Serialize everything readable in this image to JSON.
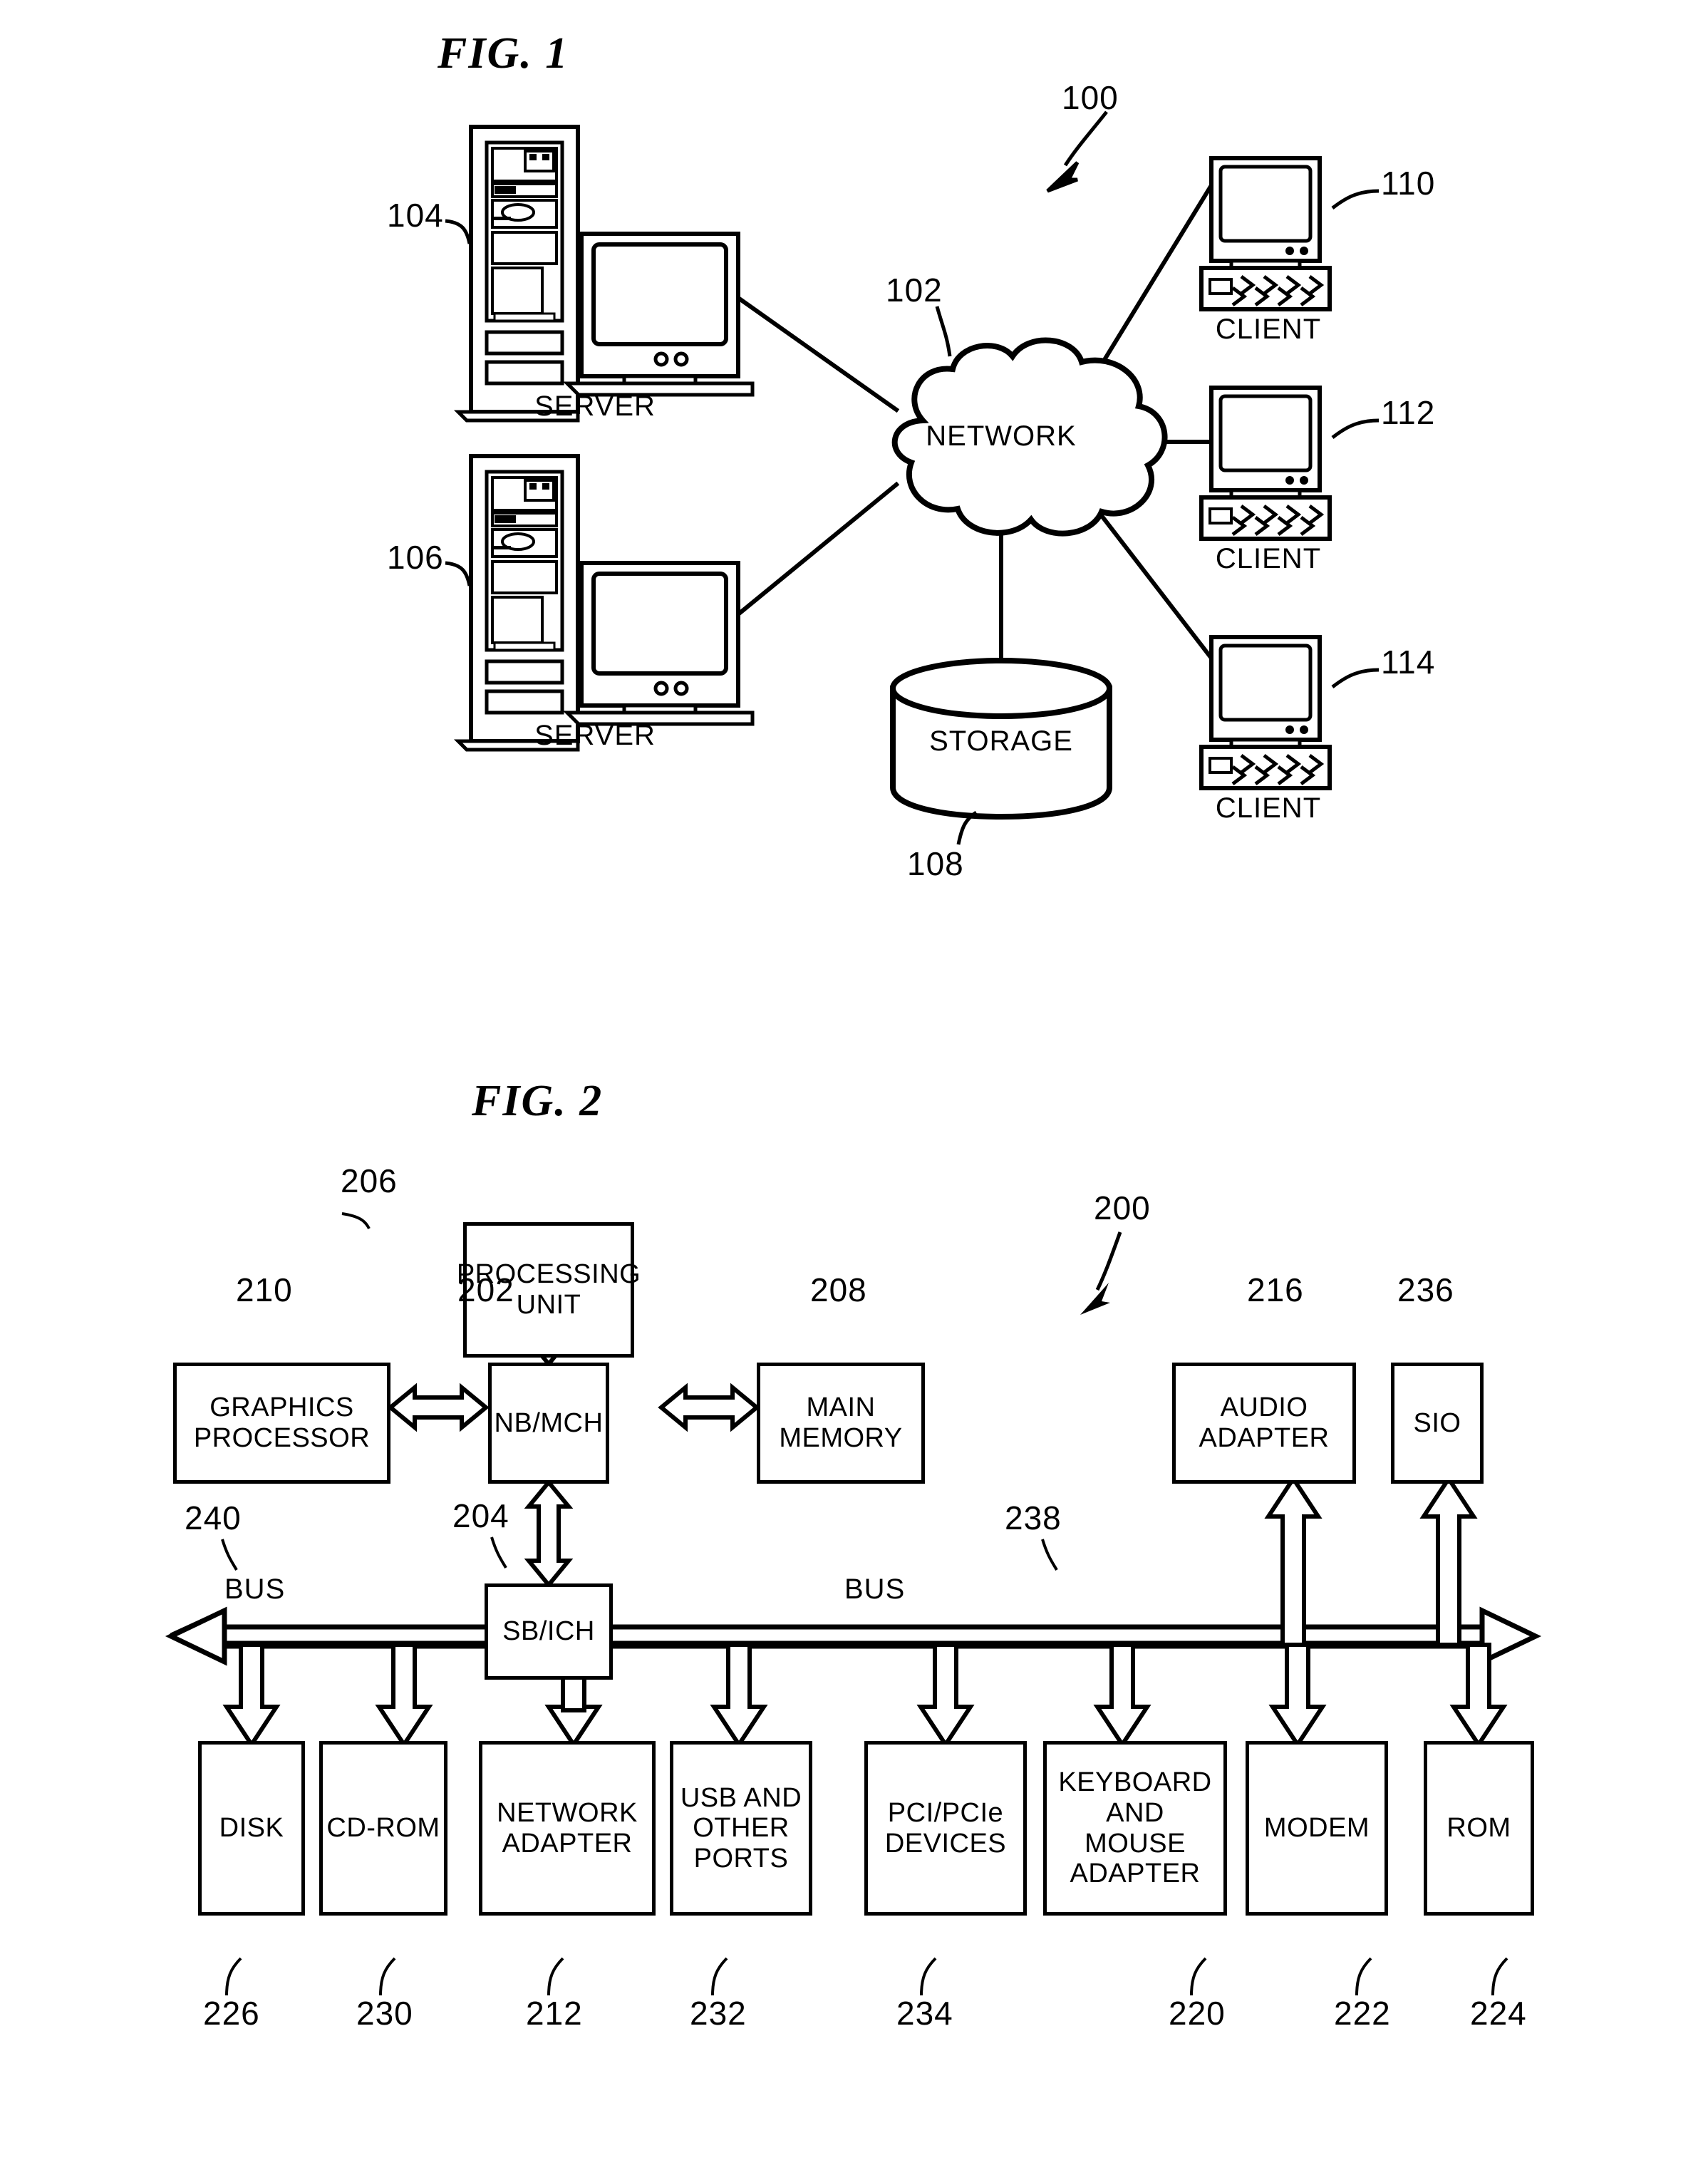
{
  "figures": [
    {
      "id": "fig1",
      "title": "FIG. 1",
      "system_ref": "100",
      "nodes": [
        {
          "ref": "104",
          "label": "SERVER",
          "type": "server-tower-with-monitor"
        },
        {
          "ref": "106",
          "label": "SERVER",
          "type": "server-tower-with-monitor"
        },
        {
          "ref": "102",
          "label": "NETWORK",
          "type": "cloud"
        },
        {
          "ref": "108",
          "label": "STORAGE",
          "type": "cylinder"
        },
        {
          "ref": "110",
          "label": "CLIENT",
          "type": "desktop-computer"
        },
        {
          "ref": "112",
          "label": "CLIENT",
          "type": "desktop-computer"
        },
        {
          "ref": "114",
          "label": "CLIENT",
          "type": "desktop-computer"
        }
      ],
      "links": [
        {
          "from": "104",
          "to": "102"
        },
        {
          "from": "106",
          "to": "102"
        },
        {
          "from": "102",
          "to": "108"
        },
        {
          "from": "102",
          "to": "110"
        },
        {
          "from": "102",
          "to": "112"
        },
        {
          "from": "102",
          "to": "114"
        }
      ]
    },
    {
      "id": "fig2",
      "title": "FIG. 2",
      "system_ref": "200",
      "blocks": [
        {
          "ref": "206",
          "label": "PROCESSING UNIT"
        },
        {
          "ref": "202",
          "label": "NB/MCH"
        },
        {
          "ref": "210",
          "label": "GRAPHICS PROCESSOR"
        },
        {
          "ref": "208",
          "label": "MAIN MEMORY"
        },
        {
          "ref": "216",
          "label": "AUDIO ADAPTER"
        },
        {
          "ref": "236",
          "label": "SIO"
        },
        {
          "ref": "204",
          "label": "SB/ICH"
        },
        {
          "ref": "226",
          "label": "DISK"
        },
        {
          "ref": "230",
          "label": "CD-ROM"
        },
        {
          "ref": "212",
          "label": "NETWORK ADAPTER"
        },
        {
          "ref": "232",
          "label": "USB AND OTHER PORTS"
        },
        {
          "ref": "234",
          "label": "PCI/PCIe DEVICES"
        },
        {
          "ref": "220",
          "label": "KEYBOARD AND MOUSE ADAPTER"
        },
        {
          "ref": "222",
          "label": "MODEM"
        },
        {
          "ref": "224",
          "label": "ROM"
        }
      ],
      "buses": [
        {
          "ref": "240",
          "label": "BUS"
        },
        {
          "ref": "238",
          "label": "BUS"
        }
      ]
    }
  ],
  "fig1": {
    "title": "FIG. 1",
    "system_ref": "100",
    "network_ref": "102",
    "network_label": "NETWORK",
    "storage_ref": "108",
    "storage_label": "STORAGE",
    "server_top": {
      "ref": "104",
      "label": "SERVER"
    },
    "server_bottom": {
      "ref": "106",
      "label": "SERVER"
    },
    "client_1": {
      "ref": "110",
      "label": "CLIENT"
    },
    "client_2": {
      "ref": "112",
      "label": "CLIENT"
    },
    "client_3": {
      "ref": "114",
      "label": "CLIENT"
    }
  },
  "fig2": {
    "title": "FIG. 2",
    "system_ref": "200",
    "processing_unit": {
      "ref": "206",
      "line1": "PROCESSING",
      "line2": "UNIT"
    },
    "nb_mch": {
      "ref": "202",
      "label": "NB/MCH"
    },
    "graphics_processor": {
      "ref": "210",
      "line1": "GRAPHICS",
      "line2": "PROCESSOR"
    },
    "main_memory": {
      "ref": "208",
      "line1": "MAIN",
      "line2": "MEMORY"
    },
    "audio_adapter": {
      "ref": "216",
      "line1": "AUDIO",
      "line2": "ADAPTER"
    },
    "sio": {
      "ref": "236",
      "label": "SIO"
    },
    "sb_ich": {
      "ref": "204",
      "label": "SB/ICH"
    },
    "bus_left": {
      "ref": "240",
      "label": "BUS"
    },
    "bus_right": {
      "ref": "238",
      "label": "BUS"
    },
    "disk": {
      "ref": "226",
      "label": "DISK"
    },
    "cdrom": {
      "ref": "230",
      "label": "CD-ROM"
    },
    "network_adapter": {
      "ref": "212",
      "line1": "NETWORK",
      "line2": "ADAPTER"
    },
    "usb_ports": {
      "ref": "232",
      "line1": "USB AND",
      "line2": "OTHER",
      "line3": "PORTS"
    },
    "pci_devices": {
      "ref": "234",
      "line1": "PCI/PCIe",
      "line2": "DEVICES"
    },
    "kb_mouse": {
      "ref": "220",
      "line1": "KEYBOARD",
      "line2": "AND",
      "line3": "MOUSE",
      "line4": "ADAPTER"
    },
    "modem": {
      "ref": "222",
      "label": "MODEM"
    },
    "rom": {
      "ref": "224",
      "label": "ROM"
    }
  },
  "colors": {
    "ink": "#000000",
    "paper": "#ffffff"
  }
}
